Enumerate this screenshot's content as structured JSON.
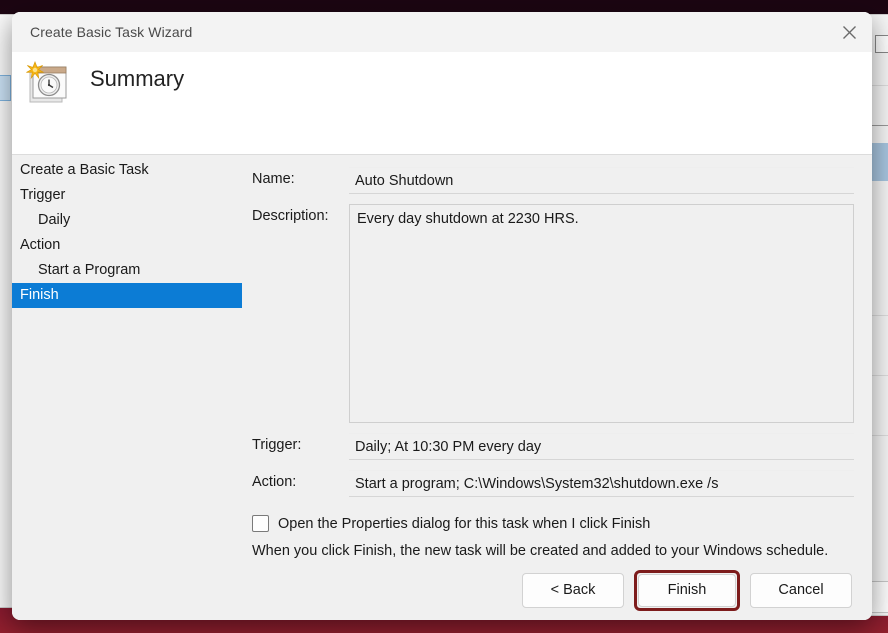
{
  "dialog": {
    "title": "Create Basic Task Wizard",
    "close_icon": "close-icon",
    "header_title": "Summary",
    "header_icon": "task-calendar-clock-icon"
  },
  "steps": [
    {
      "label": "Create a Basic Task",
      "level": 0,
      "selected": false
    },
    {
      "label": "Trigger",
      "level": 0,
      "selected": false
    },
    {
      "label": "Daily",
      "level": 1,
      "selected": false
    },
    {
      "label": "Action",
      "level": 0,
      "selected": false
    },
    {
      "label": "Start a Program",
      "level": 1,
      "selected": false
    },
    {
      "label": "Finish",
      "level": 0,
      "selected": true
    }
  ],
  "form": {
    "name_label": "Name:",
    "name_value": "Auto Shutdown",
    "description_label": "Description:",
    "description_value": "Every day shutdown at 2230 HRS.",
    "trigger_label": "Trigger:",
    "trigger_value": "Daily; At 10:30 PM every day",
    "action_label": "Action:",
    "action_value": "Start a program; C:\\Windows\\System32\\shutdown.exe /s",
    "checkbox_label": "Open the Properties dialog for this task when I click Finish",
    "checkbox_checked": false,
    "note": "When you click Finish, the new task will be created and added to your Windows schedule."
  },
  "footer": {
    "back_label": "< Back",
    "finish_label": "Finish",
    "cancel_label": "Cancel"
  },
  "colors": {
    "selection_blue": "#0c7cd5",
    "highlight_red": "#7d1c1c",
    "dialog_background": "#f0f0f0",
    "header_background": "#ffffff"
  }
}
